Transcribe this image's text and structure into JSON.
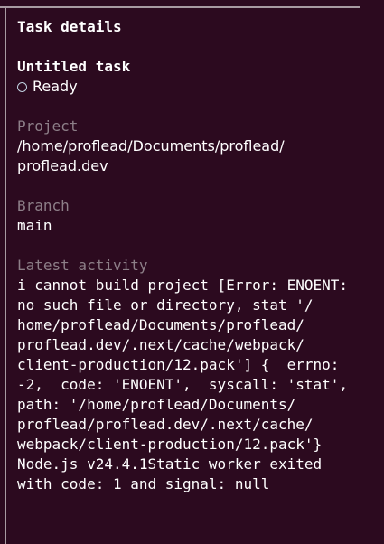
{
  "panel": {
    "title": "Task details"
  },
  "task": {
    "name": "Untitled task",
    "status": "Ready"
  },
  "project": {
    "label": "Project",
    "path_line1": "/home/proflead/Documents/proflead/",
    "path_line2": "proflead.dev"
  },
  "branch": {
    "label": "Branch",
    "value": "main"
  },
  "activity": {
    "label": "Latest activity",
    "lines": [
      "i cannot build project [Error: ENOENT:",
      "no such file or directory, stat '/",
      "home/proflead/Documents/proflead/",
      "proflead.dev/.next/cache/webpack/",
      "client-production/12.pack'] {  errno:",
      "-2,  code: 'ENOENT',  syscall: 'stat',",
      "path: '/home/proflead/Documents/",
      "proflead/proflead.dev/.next/cache/",
      "webpack/client-production/12.pack'}",
      "Node.js v24.4.1Static worker exited",
      "with code: 1 and signal: null"
    ]
  },
  "colors": {
    "background": "#2c0a1f",
    "text": "#ffffff",
    "muted_label": "#8d7f88",
    "rule": "#a79aa1",
    "status_circle": "#bfd0df"
  }
}
